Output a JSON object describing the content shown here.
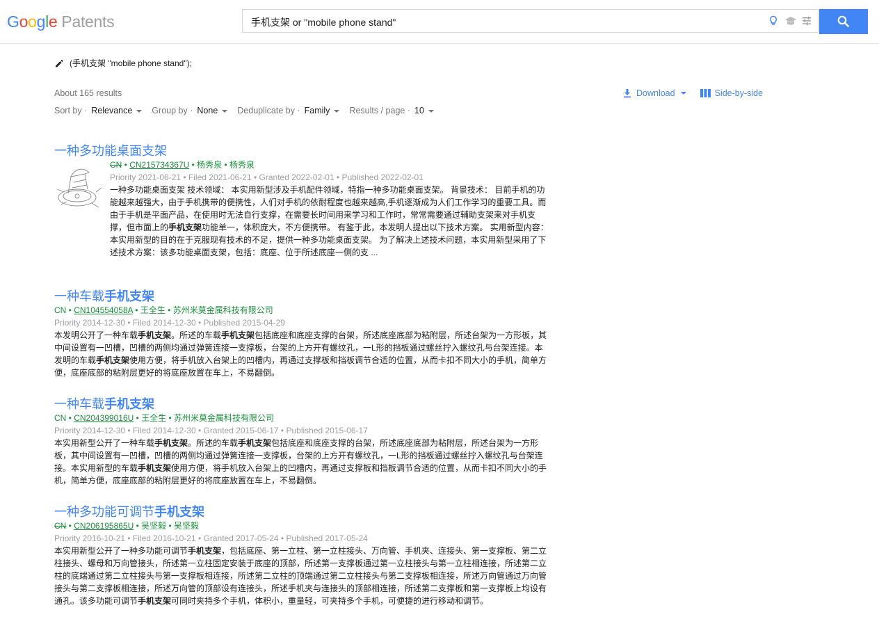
{
  "header": {
    "logo_google_letters": [
      "G",
      "o",
      "o",
      "g",
      "l",
      "e"
    ],
    "logo_suffix": "Patents",
    "search_query": "手机支架 or \"mobile phone stand\"",
    "icons": [
      "lightbulb-icon",
      "mortarboard-icon",
      "tune-icon",
      "search-icon"
    ]
  },
  "query_summary": "(手机支架 \"mobile phone stand\");",
  "results_count": "About 165 results",
  "controls": {
    "sort_label": "Sort by",
    "sort_value": "Relevance",
    "group_label": "Group by",
    "group_value": "None",
    "dedupe_label": "Deduplicate by",
    "dedupe_value": "Family",
    "per_page_label": "Results / page",
    "per_page_value": "10"
  },
  "actions": {
    "download": "Download",
    "side_by_side": "Side-by-side"
  },
  "results": [
    {
      "title_plain": "一种多功能桌面支架",
      "title_bold": "",
      "country": "CN",
      "country_struck": true,
      "number": "CN215734367U",
      "people": "杨秀泉 • 杨秀泉",
      "dates": "Priority 2021-06-21 • Filed 2021-06-21 • Granted 2022-02-01 • Published 2022-02-01",
      "snippet_parts": [
        "一种多功能桌面支架 技术领域：  本实用新型涉及手机配件领域，特指一种多功能桌面支架。  背景技术：  目前手机的功能越来越强大，由于手机携带的便携性，人们对手机的依耐程度也越来越高,手机逐渐成为人们工作学习的重要工具。而由于手机是平面产品，在使用时无法自行支撑，在需要长时间用来学习和工作时，常常需要通过辅助支架来对手机支撑，但市面上的",
        "手机支架",
        "功能单一，体积庞大，不方便携带。  有鉴于此，本发明人提出以下技术方案。  实用新型内容：  本实用新型的目的在于克服现有技术的不足，提供一种多功能桌面支架。  为了解决上述技术问题，本实用新型采用了下述技术方案：该多功能桌面支架，包括：底座、位于所述底座一侧的支 ..."
      ],
      "has_thumb": true
    },
    {
      "title_plain": "一种车载",
      "title_bold": "手机支架",
      "country": "CN",
      "country_struck": false,
      "number": "CN104554058A",
      "people": "王全生 • 苏州米莫金属科技有限公司",
      "dates": "Priority 2014-12-30 • Filed 2014-12-30 • Published 2015-04-29",
      "snippet_parts": [
        "本发明公开了一种车载",
        "手机支架",
        "。所述的车载",
        "手机支架",
        "包括底座和底座支撑的台架，所述底座底部为粘附层，所述台架为一方形板，其中间设置有一凹槽，凹槽的两侧均通过弹簧连接一支撑板，台架的上方开有螺纹孔，一L形的挡板通过螺丝拧入螺纹孔与台架连接。本发明的车载",
        "手机支架",
        "使用方便，将手机放入台架上的凹槽内，再通过支撑板和挡板调节合适的位置，从而卡扣不同大小的手机，简单方便，底座底部的粘附层更好的将底座放置在车上，不易翻倒。"
      ],
      "has_thumb": false
    },
    {
      "title_plain": "一种车载",
      "title_bold": "手机支架",
      "country": "CN",
      "country_struck": false,
      "number": "CN204399016U",
      "people": "王全生 • 苏州米莫金属科技有限公司",
      "dates": "Priority 2014-12-30 • Filed 2014-12-30 • Granted 2015-06-17 • Published 2015-06-17",
      "snippet_parts": [
        "本实用新型公开了一种车载",
        "手机支架",
        "。所述的车载",
        "手机支架",
        "包括底座和底座支撑的台架，所述底座底部为粘附层，所述台架为一方形板，其中间设置有一凹槽，凹槽的两侧均通过弹簧连接一支撑板，台架的上方开有螺纹孔，一L形的挡板通过螺丝拧入螺纹孔与台架连接。本实用新型的车载",
        "手机支架",
        "使用方便，将手机放入台架上的凹槽内，再通过支撑板和挡板调节合适的位置，从而卡扣不同大小的手机，简单方便，底座底部的粘附层更好的将底座放置在车上，不易翻倒。"
      ],
      "has_thumb": false
    },
    {
      "title_plain": "一种多功能可调节",
      "title_bold": "手机支架",
      "country": "CN",
      "country_struck": true,
      "number": "CN206195865U",
      "people": "吴坚毅 • 吴坚毅",
      "dates": "Priority 2016-10-21 • Filed 2016-10-21 • Granted 2017-05-24 • Published 2017-05-24",
      "snippet_parts": [
        "本实用新型公开了一种多功能可调节",
        "手机支架",
        "，包括底座、第一立柱、第一立柱接头、万向管、手机夹、连接头、第一支撑板、第二立柱接头、螺母和万向管接头，所述第一立柱固定安装于底座的顶部，所述第一支撑板通过第一立柱接头与第一立柱相连接，所述第二立柱的底端通过第二立柱接头与第一支撑板相连接，所述第二立柱的顶端通过第二立柱接头与第二支撑板相连接，所述万向管通过万向管接头与第二支撑板相连接，所述万向管的顶部设有连接头，所述手机夹与连接头的顶部相连接，所述第二支撑板和第一支撑板上均设有通孔。该多功能可调节",
        "手机支架",
        "可同时夹持多个手机，体积小，重量轻，可夹持多个手机，可便捷的进行移动和调节。"
      ],
      "has_thumb": false
    }
  ]
}
